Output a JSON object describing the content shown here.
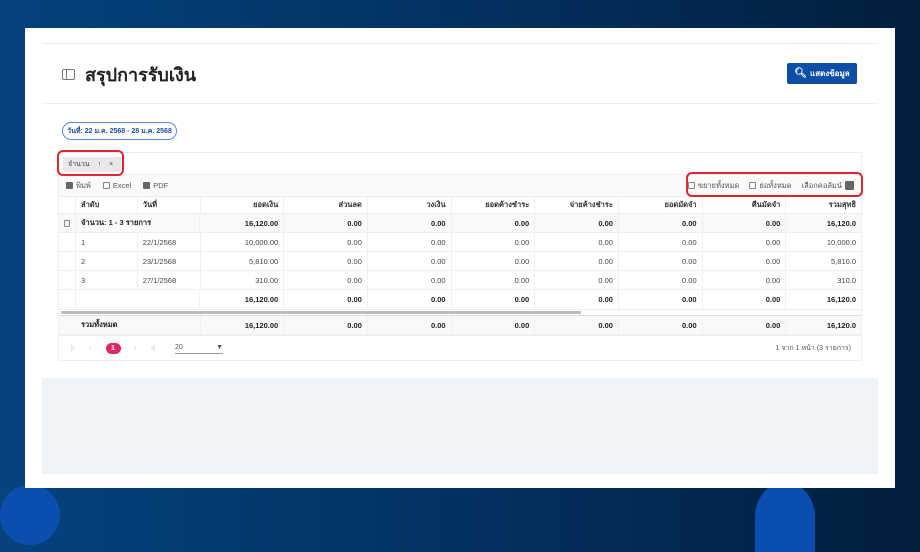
{
  "header": {
    "title": "สรุปการรับเงิน",
    "show_button": "แสดงข้อมูล"
  },
  "filter": {
    "date_range": "วันที่: 22 ม.ค. 2568 - 28 ม.ค. 2568"
  },
  "group_panel": {
    "chip_label": "จำนวน",
    "sort": "↑",
    "remove": "×"
  },
  "toolbar": {
    "print": "พิมพ์",
    "excel": "Excel",
    "pdf": "PDF",
    "expand_all": "ขยายทั้งหมด",
    "collapse_all": "ย่อทั้งหมด",
    "choose_columns": "เลือกคอลัมน์"
  },
  "table": {
    "columns": [
      "ลำดับ",
      "วันที่",
      "ยอดเงิน",
      "ส่วนลด",
      "วงเงิน",
      "ยอดค้างชำระ",
      "จ่ายค้างชำระ",
      "ยอดมัดจำ",
      "คืนมัดจำ",
      "รวมสุทธิ"
    ],
    "group": {
      "label": "จำนวน: 1 - 3 รายการ",
      "values": [
        "16,120.00",
        "0.00",
        "0.00",
        "0.00",
        "0.00",
        "0.00",
        "0.00",
        "16,120.0"
      ]
    },
    "rows": [
      {
        "no": "1",
        "date": "22/1/2568",
        "values": [
          "10,000.00",
          "0.00",
          "0.00",
          "0.00",
          "0.00",
          "0.00",
          "0.00",
          "10,000.0"
        ]
      },
      {
        "no": "2",
        "date": "23/1/2568",
        "values": [
          "5,810.00",
          "0.00",
          "0.00",
          "0.00",
          "0.00",
          "0.00",
          "0.00",
          "5,810.0"
        ]
      },
      {
        "no": "3",
        "date": "27/1/2568",
        "values": [
          "310.00",
          "0.00",
          "0.00",
          "0.00",
          "0.00",
          "0.00",
          "0.00",
          "310.0"
        ]
      }
    ],
    "subtotal": [
      "16,120.00",
      "0.00",
      "0.00",
      "0.00",
      "0.00",
      "0.00",
      "0.00",
      "16,120.0"
    ],
    "total": {
      "label": "รวมทั้งหมด",
      "values": [
        "16,120.00",
        "0.00",
        "0.00",
        "0.00",
        "0.00",
        "0.00",
        "0.00",
        "16,120.0"
      ]
    }
  },
  "pager": {
    "first": "|‹",
    "prev": "‹",
    "current": "1",
    "next": "›",
    "last": "›|",
    "page_size": "20",
    "info": "1 จาก 1 หน้า (3 รายการ)"
  }
}
